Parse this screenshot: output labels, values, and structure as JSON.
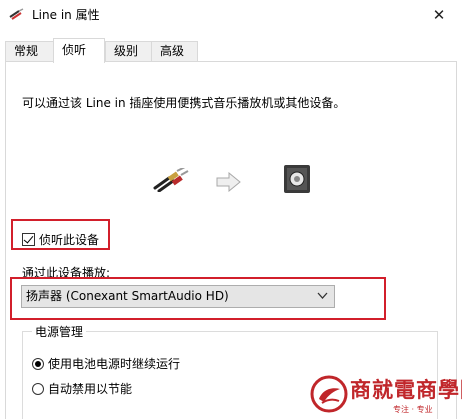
{
  "window": {
    "title": "Line in 属性",
    "close_glyph": "✕"
  },
  "tabs": [
    {
      "label": "常规",
      "active": false
    },
    {
      "label": "侦听",
      "active": true
    },
    {
      "label": "级别",
      "active": false
    },
    {
      "label": "高级",
      "active": false
    }
  ],
  "listen": {
    "description": "可以通过该 Line in 插座使用便携式音乐播放机或其他设备。",
    "checkbox_label": "侦听此设备",
    "checkbox_checked": true,
    "playback_label": "通过此设备播放:",
    "playback_device": "扬声器 (Conexant SmartAudio HD)"
  },
  "power": {
    "group_title": "电源管理",
    "options": [
      {
        "label": "使用电池电源时继续运行",
        "selected": true
      },
      {
        "label": "自动禁用以节能",
        "selected": false
      }
    ]
  },
  "watermark": {
    "text": "商就電商學院",
    "sub": "专注 · 专业"
  },
  "colors": {
    "highlight": "#d21f2b",
    "watermark": "#c0262a"
  },
  "icons": [
    "audio-jack-icon",
    "arrow-right-icon",
    "speaker-icon",
    "close-icon",
    "chevron-down-icon"
  ]
}
